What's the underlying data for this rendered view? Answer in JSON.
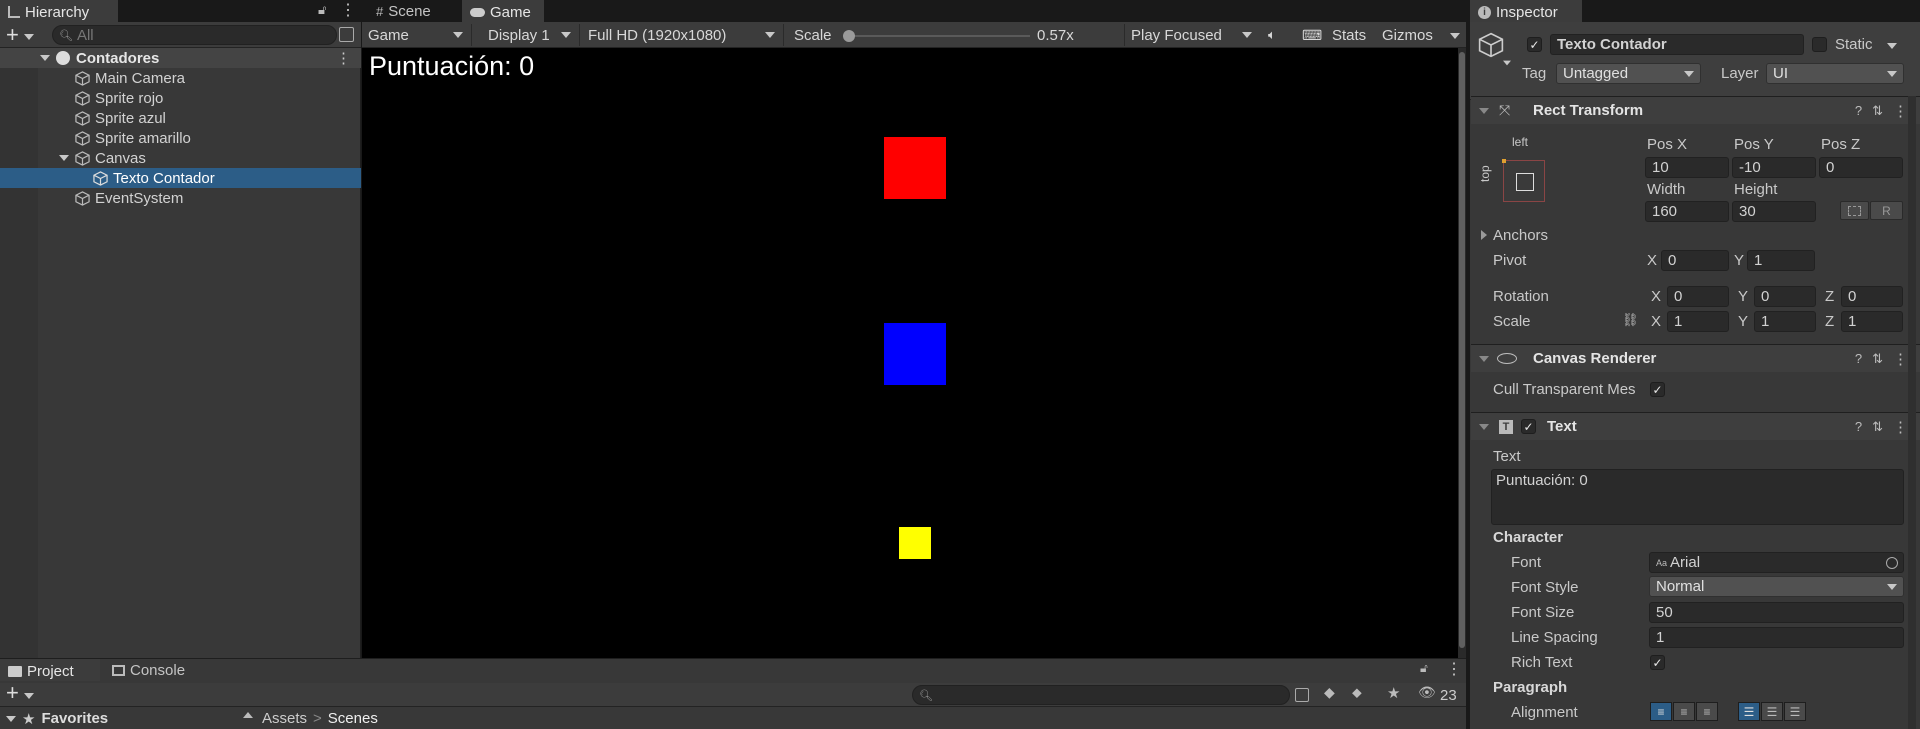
{
  "hierarchy": {
    "tab": "Hierarchy",
    "search_placeholder": "All",
    "scene": "Contadores",
    "items": [
      {
        "label": "Main Camera"
      },
      {
        "label": "Sprite rojo"
      },
      {
        "label": "Sprite azul"
      },
      {
        "label": "Sprite amarillo"
      },
      {
        "label": "Canvas"
      },
      {
        "label": "Texto Contador"
      },
      {
        "label": "EventSystem"
      }
    ]
  },
  "tabs": {
    "scene": "Scene",
    "game": "Game"
  },
  "game_toolbar": {
    "mode": "Game",
    "display": "Display 1",
    "resolution": "Full HD (1920x1080)",
    "scale_label": "Scale",
    "scale_value": "0.57x",
    "play_mode": "Play Focused",
    "stats": "Stats",
    "gizmos": "Gizmos",
    "scale_fraction": 0.0
  },
  "game_view": {
    "score_text": "Puntuación: 0",
    "colors": {
      "red": "#ff0000",
      "blue": "#0000ff",
      "yellow": "#ffff00",
      "background": "#000000"
    }
  },
  "bottom": {
    "project_tab": "Project",
    "console_tab": "Console",
    "favorites": "Favorites",
    "breadcrumb": [
      "Assets",
      "Scenes"
    ],
    "hidden_count": "23"
  },
  "inspector": {
    "tab": "Inspector",
    "object_name": "Texto Contador",
    "static_label": "Static",
    "tag_label": "Tag",
    "tag_value": "Untagged",
    "layer_label": "Layer",
    "layer_value": "UI",
    "rect_transform": {
      "title": "Rect Transform",
      "anchor_h": "left",
      "anchor_v": "top",
      "pos_x_label": "Pos X",
      "pos_x": "10",
      "pos_y_label": "Pos Y",
      "pos_y": "-10",
      "pos_z_label": "Pos Z",
      "pos_z": "0",
      "width_label": "Width",
      "width": "160",
      "height_label": "Height",
      "height": "30",
      "r_button": "R",
      "anchors_label": "Anchors",
      "pivot_label": "Pivot",
      "pivot_x": "0",
      "pivot_y": "1",
      "rotation_label": "Rotation",
      "rot_x": "0",
      "rot_y": "0",
      "rot_z": "0",
      "scale_label": "Scale",
      "scale_x": "1",
      "scale_y": "1",
      "scale_z": "1",
      "x": "X",
      "y": "Y",
      "z": "Z"
    },
    "canvas_renderer": {
      "title": "Canvas Renderer",
      "cull_label": "Cull Transparent Mes"
    },
    "text_component": {
      "title": "Text",
      "text_label": "Text",
      "text_value": "Puntuación: 0",
      "character_label": "Character",
      "font_label": "Font",
      "font_value": "Arial",
      "font_style_label": "Font Style",
      "font_style_value": "Normal",
      "font_size_label": "Font Size",
      "font_size_value": "50",
      "line_spacing_label": "Line Spacing",
      "line_spacing_value": "1",
      "rich_text_label": "Rich Text",
      "paragraph_label": "Paragraph",
      "alignment_label": "Alignment"
    }
  }
}
